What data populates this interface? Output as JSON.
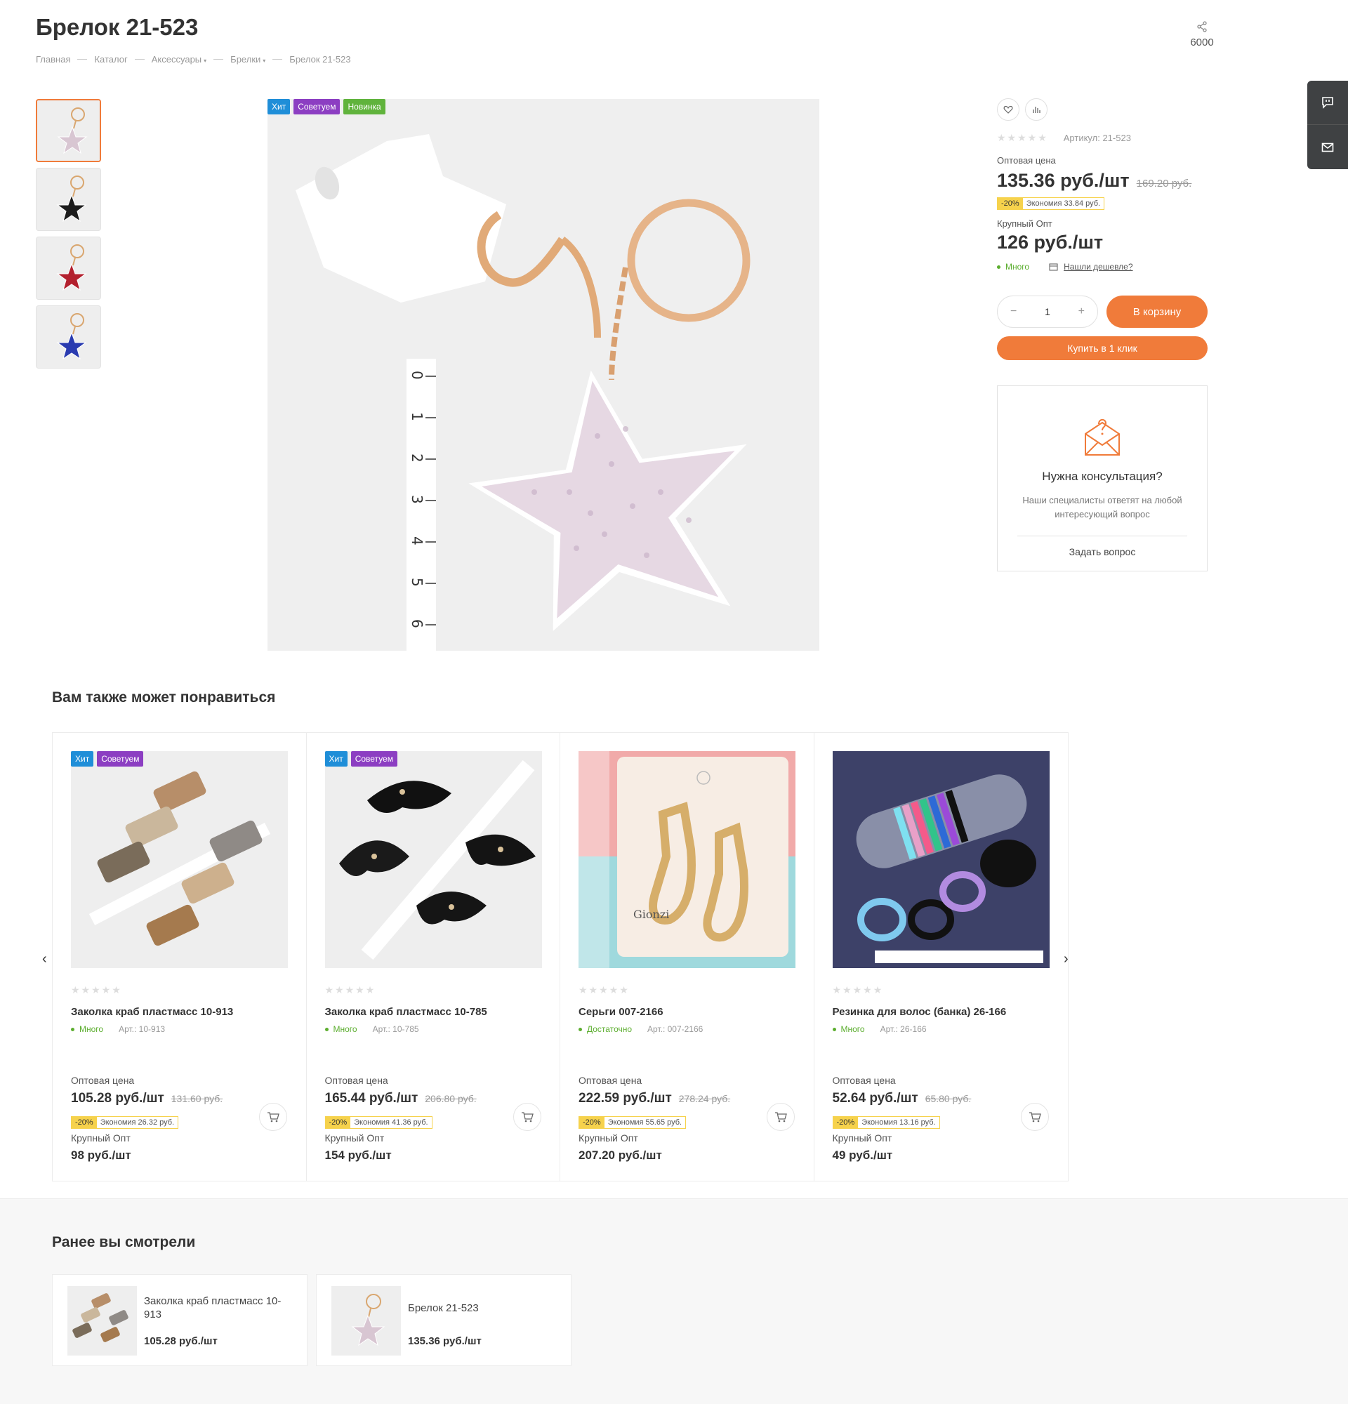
{
  "product": {
    "title": "Брелок 21-523",
    "breadcrumb": [
      "Главная",
      "Каталог",
      "Аксессуары",
      "Брелки",
      "Брелок 21-523"
    ],
    "share_count": "6000",
    "badges": [
      "Хит",
      "Советуем",
      "Новинка"
    ],
    "sku": "Артикул: 21-523",
    "wholesale_label": "Оптовая цена",
    "wholesale_price": "135.36 руб./шт",
    "old_price": "169.20 руб.",
    "discount": "-20%",
    "savings": "Экономия 33.84 руб.",
    "bulk_label": "Крупный Опт",
    "bulk_price": "126 руб./шт",
    "stock": "Много",
    "cheaper_link": "Нашли дешевле?",
    "quantity": "1",
    "add_to_cart": "В корзину",
    "buy_one_click": "Купить в 1 клик"
  },
  "consult": {
    "title": "Нужна консультация?",
    "text": "Наши специалисты ответят на любой интересующий вопрос",
    "ask": "Задать вопрос"
  },
  "recommend": {
    "title": "Вам также может понравиться",
    "items": [
      {
        "name": "Заколка краб пластмасс 10-913",
        "stock": "Много",
        "art": "Арт.: 10-913",
        "price_label": "Оптовая цена",
        "price": "105.28 руб./шт",
        "old": "131.60 руб.",
        "discount": "-20%",
        "savings": "Экономия 26.32 руб.",
        "bulk_label": "Крупный Опт",
        "bulk": "98 руб./шт",
        "badges": [
          "Хит",
          "Советуем"
        ]
      },
      {
        "name": "Заколка краб пластмасс 10-785",
        "stock": "Много",
        "art": "Арт.: 10-785",
        "price_label": "Оптовая цена",
        "price": "165.44 руб./шт",
        "old": "206.80 руб.",
        "discount": "-20%",
        "savings": "Экономия 41.36 руб.",
        "bulk_label": "Крупный Опт",
        "bulk": "154 руб./шт",
        "badges": [
          "Хит",
          "Советуем"
        ]
      },
      {
        "name": "Серьги 007-2166",
        "stock": "Достаточно",
        "art": "Арт.: 007-2166",
        "price_label": "Оптовая цена",
        "price": "222.59 руб./шт",
        "old": "278.24 руб.",
        "discount": "-20%",
        "savings": "Экономия 55.65 руб.",
        "bulk_label": "Крупный Опт",
        "bulk": "207.20 руб./шт",
        "badges": []
      },
      {
        "name": "Резинка для волос (банка) 26-166",
        "stock": "Много",
        "art": "Арт.: 26-166",
        "price_label": "Оптовая цена",
        "price": "52.64 руб./шт",
        "old": "65.80 руб.",
        "discount": "-20%",
        "savings": "Экономия 13.16 руб.",
        "bulk_label": "Крупный Опт",
        "bulk": "49 руб./шт",
        "badges": []
      }
    ]
  },
  "viewed": {
    "title": "Ранее вы смотрели",
    "items": [
      {
        "name": "Заколка краб пластмасс 10-913",
        "price": "105.28 руб./шт"
      },
      {
        "name": "Брелок 21-523",
        "price": "135.36 руб./шт"
      }
    ]
  },
  "colors": {
    "accent": "#f07b3a",
    "badge_blue": "#1f8ed8",
    "badge_purple": "#8c3ec2",
    "badge_green": "#60b33c",
    "stock_green": "#5cae2f",
    "savings_yellow": "#f6d24c"
  }
}
